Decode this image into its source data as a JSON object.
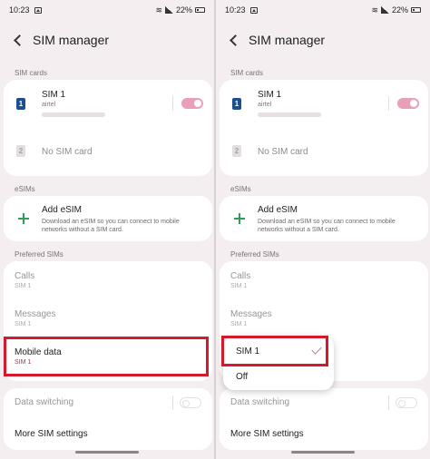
{
  "status": {
    "time": "10:23",
    "battery": "22%"
  },
  "header": {
    "title": "SIM manager"
  },
  "sections": {
    "sim_cards": "SIM cards",
    "esims": "eSIMs",
    "preferred_sims": "Preferred SIMs"
  },
  "sim1": {
    "name": "SIM 1",
    "carrier": "airtel",
    "badge": "1",
    "enabled": true
  },
  "sim2": {
    "badge": "2",
    "label": "No SIM card"
  },
  "esim": {
    "title": "Add eSIM",
    "description": "Download an eSIM so you can connect to mobile networks without a SIM card."
  },
  "preferred": {
    "calls": {
      "label": "Calls",
      "value": "SIM 1"
    },
    "messages": {
      "label": "Messages",
      "value": "SIM 1"
    },
    "mobile_data": {
      "label": "Mobile data",
      "value": "SIM 1"
    }
  },
  "data_switching": {
    "label": "Data switching",
    "enabled": false
  },
  "more_settings": {
    "label": "More SIM settings"
  },
  "popup": {
    "options": [
      "SIM 1",
      "Off"
    ],
    "selected": "SIM 1"
  },
  "colors": {
    "accent": "#9c3a58",
    "highlight": "#d5182a",
    "toggle_on": "#e8a0b8",
    "add_icon": "#2f9c5c",
    "sim_badge": "#1f4e8c"
  }
}
